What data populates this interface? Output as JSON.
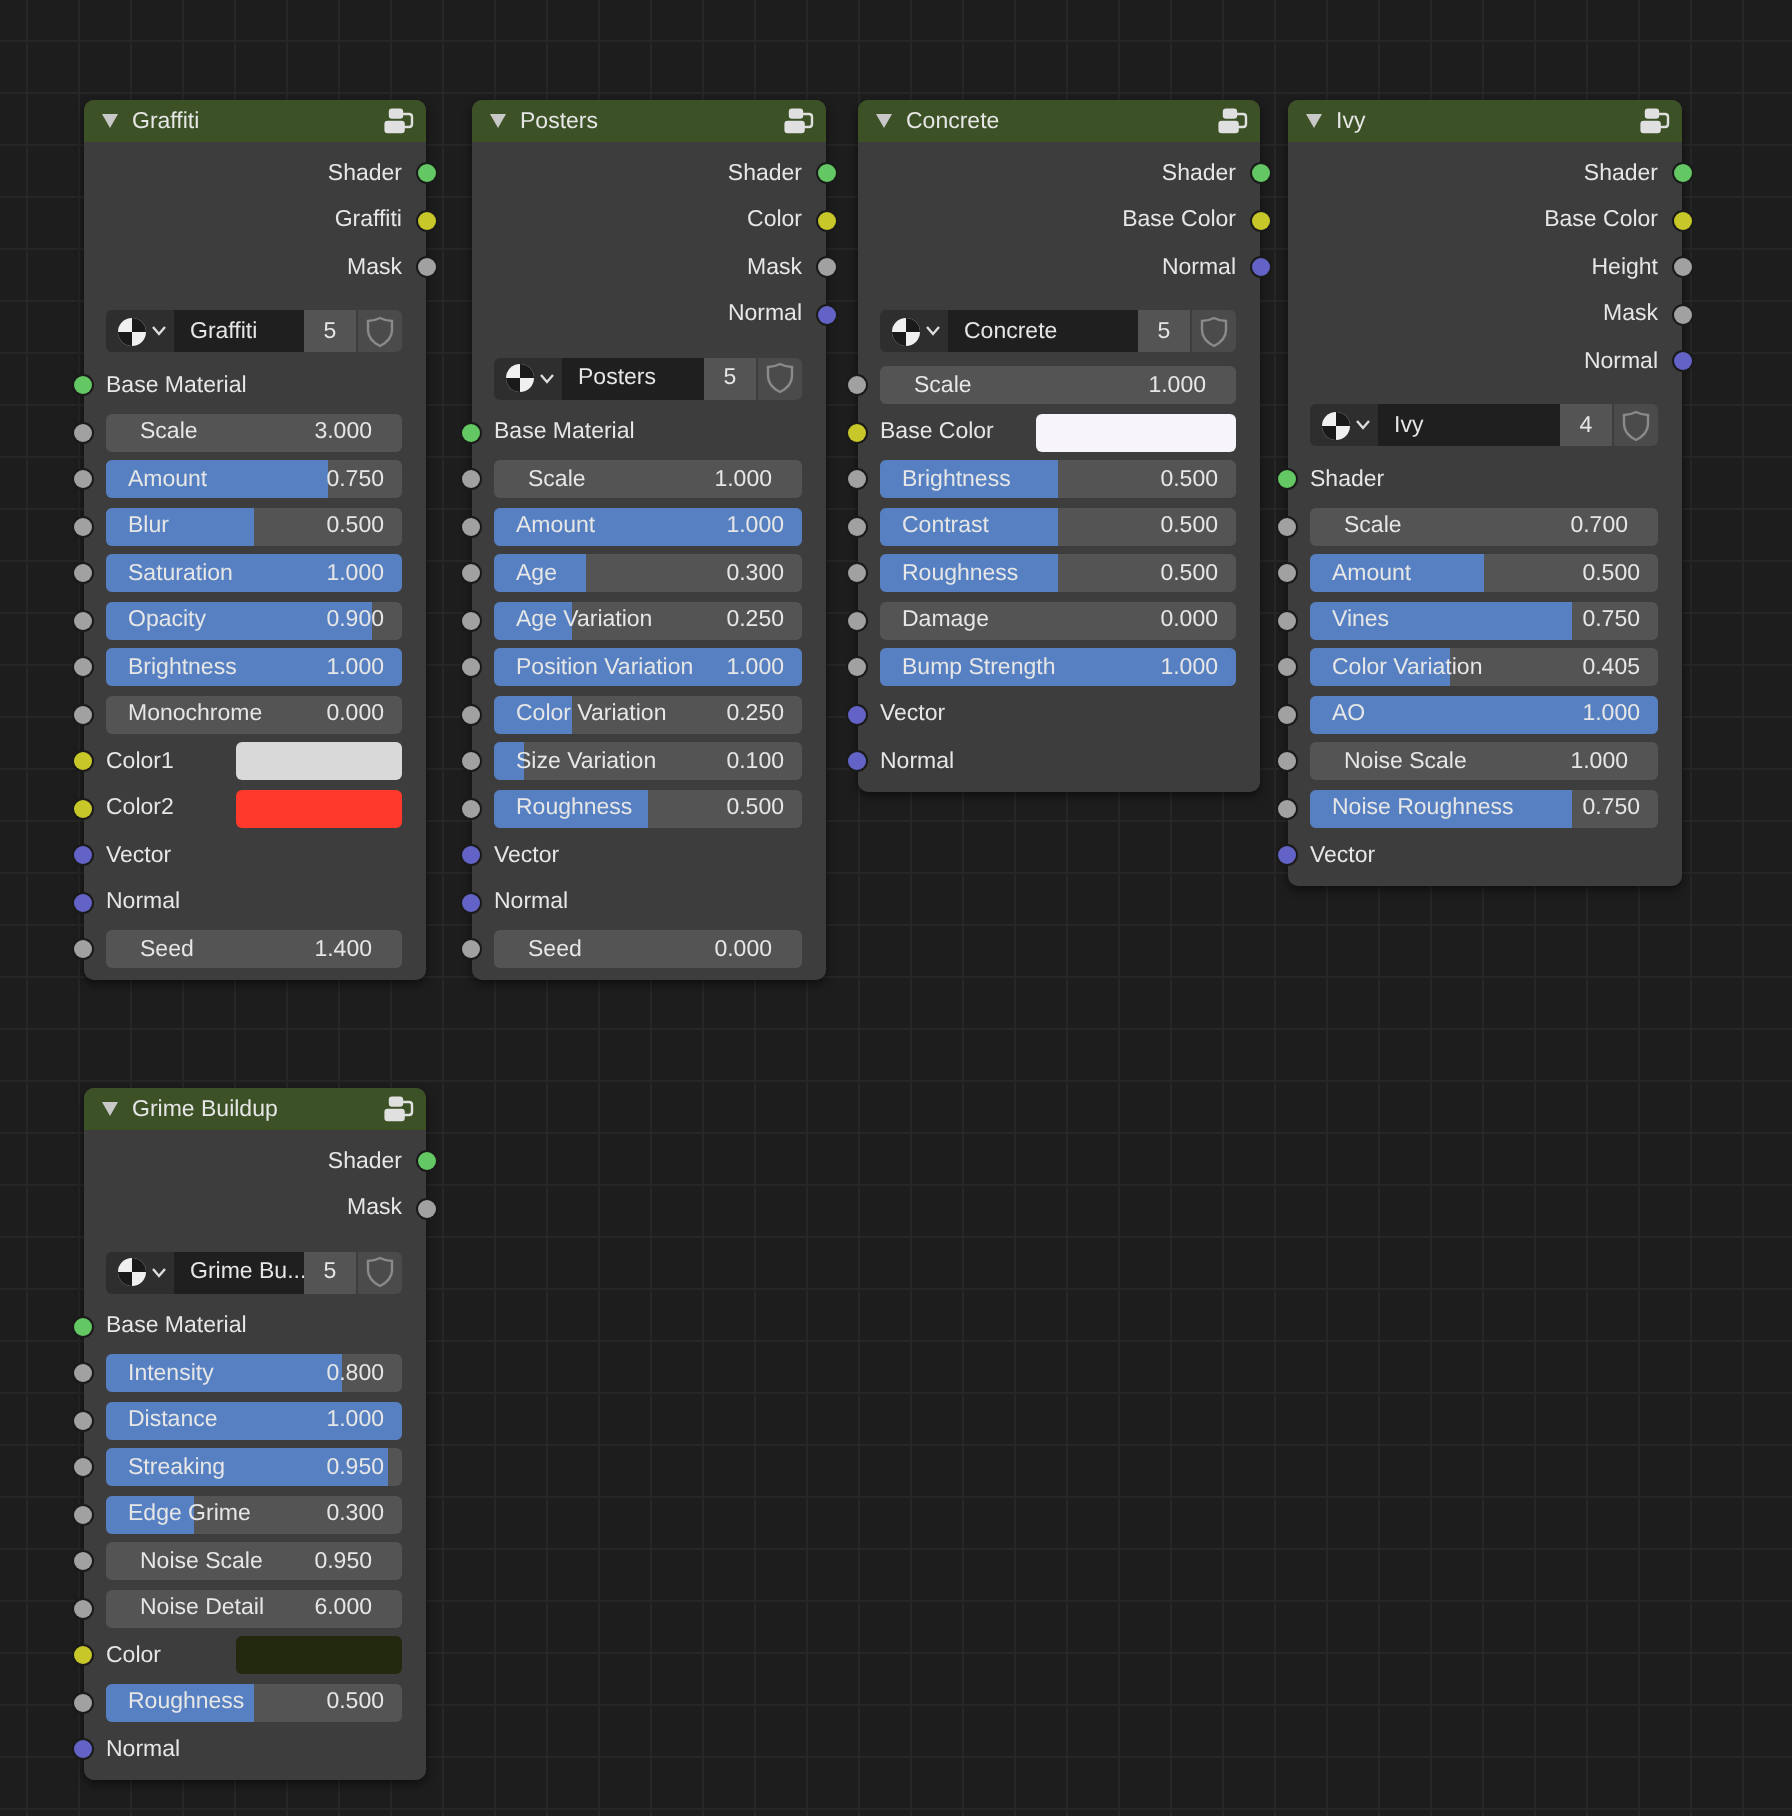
{
  "nodes": [
    {
      "title": "Graffiti",
      "outputs": [
        {
          "label": "Shader",
          "color": "#63c763"
        },
        {
          "label": "Graffiti",
          "color": "#c7c729"
        },
        {
          "label": "Mask",
          "color": "#a1a1a1"
        }
      ],
      "material": {
        "name": "Graffiti",
        "users": "5"
      },
      "inputs": [
        {
          "kind": "label",
          "label": "Base Material",
          "color": "#63c763"
        },
        {
          "kind": "number",
          "label": "Scale",
          "value": "3.000",
          "color": "#a1a1a1"
        },
        {
          "kind": "slider",
          "label": "Amount",
          "value": "0.750",
          "level": 0.75,
          "color": "#a1a1a1"
        },
        {
          "kind": "slider",
          "label": "Blur",
          "value": "0.500",
          "level": 0.5,
          "color": "#a1a1a1"
        },
        {
          "kind": "slider",
          "label": "Saturation",
          "value": "1.000",
          "level": 1,
          "color": "#a1a1a1"
        },
        {
          "kind": "slider",
          "label": "Opacity",
          "value": "0.900",
          "level": 0.9,
          "color": "#a1a1a1"
        },
        {
          "kind": "slider",
          "label": "Brightness",
          "value": "1.000",
          "level": 1,
          "color": "#a1a1a1"
        },
        {
          "kind": "slider",
          "label": "Monochrome",
          "value": "0.000",
          "color": "#a1a1a1"
        },
        {
          "kind": "color",
          "label": "Color1",
          "swatch": {
            "color": "#d9d9d9"
          },
          "color": "#c7c729"
        },
        {
          "kind": "color",
          "label": "Color2",
          "swatch": {
            "color": "#ff3a2c"
          },
          "color": "#c7c729"
        },
        {
          "kind": "label",
          "label": "Vector",
          "color": "#6363c7"
        },
        {
          "kind": "label",
          "label": "Normal",
          "color": "#6363c7"
        },
        {
          "kind": "number",
          "label": "Seed",
          "value": "1.400",
          "color": "#a1a1a1"
        }
      ]
    },
    {
      "title": "Posters",
      "outputs": [
        {
          "label": "Shader",
          "color": "#63c763"
        },
        {
          "label": "Color",
          "color": "#c7c729"
        },
        {
          "label": "Mask",
          "color": "#a1a1a1"
        },
        {
          "label": "Normal",
          "color": "#6363c7"
        }
      ],
      "material": {
        "name": "Posters",
        "users": "5"
      },
      "inputs": [
        {
          "kind": "label",
          "label": "Base Material",
          "color": "#63c763"
        },
        {
          "kind": "number",
          "label": "Scale",
          "value": "1.000",
          "color": "#a1a1a1"
        },
        {
          "kind": "slider",
          "label": "Amount",
          "value": "1.000",
          "level": 1,
          "color": "#a1a1a1"
        },
        {
          "kind": "slider",
          "label": "Age",
          "value": "0.300",
          "level": 0.3,
          "color": "#a1a1a1"
        },
        {
          "kind": "slider",
          "label": "Age Variation",
          "value": "0.250",
          "level": 0.25,
          "color": "#a1a1a1"
        },
        {
          "kind": "slider",
          "label": "Position Variation",
          "value": "1.000",
          "level": 1,
          "color": "#a1a1a1"
        },
        {
          "kind": "slider",
          "label": "Color Variation",
          "value": "0.250",
          "level": 0.25,
          "color": "#a1a1a1"
        },
        {
          "kind": "slider",
          "label": "Size Variation",
          "value": "0.100",
          "level": 0.1,
          "color": "#a1a1a1"
        },
        {
          "kind": "slider",
          "label": "Roughness",
          "value": "0.500",
          "level": 0.5,
          "color": "#a1a1a1"
        },
        {
          "kind": "label",
          "label": "Vector",
          "color": "#6363c7"
        },
        {
          "kind": "label",
          "label": "Normal",
          "color": "#6363c7"
        },
        {
          "kind": "number",
          "label": "Seed",
          "value": "0.000",
          "color": "#a1a1a1"
        }
      ]
    },
    {
      "title": "Concrete",
      "outputs": [
        {
          "label": "Shader",
          "color": "#63c763"
        },
        {
          "label": "Base Color",
          "color": "#c7c729"
        },
        {
          "label": "Normal",
          "color": "#6363c7"
        }
      ],
      "material": {
        "name": "Concrete",
        "users": "5"
      },
      "inputs": [
        {
          "kind": "number",
          "label": "Scale",
          "value": "1.000",
          "color": "#a1a1a1"
        },
        {
          "kind": "color",
          "label": "Base Color",
          "swatch": {
            "color": "#f8f4fc"
          },
          "color": "#c7c729"
        },
        {
          "kind": "slider",
          "label": "Brightness",
          "value": "0.500",
          "level": 0.5,
          "color": "#a1a1a1"
        },
        {
          "kind": "slider",
          "label": "Contrast",
          "value": "0.500",
          "level": 0.5,
          "color": "#a1a1a1"
        },
        {
          "kind": "slider",
          "label": "Roughness",
          "value": "0.500",
          "level": 0.5,
          "color": "#a1a1a1"
        },
        {
          "kind": "slider",
          "label": "Damage",
          "value": "0.000",
          "color": "#a1a1a1"
        },
        {
          "kind": "slider",
          "label": "Bump Strength",
          "value": "1.000",
          "level": 1,
          "color": "#a1a1a1"
        },
        {
          "kind": "label",
          "label": "Vector",
          "color": "#6363c7"
        },
        {
          "kind": "label",
          "label": "Normal",
          "color": "#6363c7"
        }
      ]
    },
    {
      "title": "Ivy",
      "outputs": [
        {
          "label": "Shader",
          "color": "#63c763"
        },
        {
          "label": "Base Color",
          "color": "#c7c729"
        },
        {
          "label": "Height",
          "color": "#a1a1a1"
        },
        {
          "label": "Mask",
          "color": "#a1a1a1"
        },
        {
          "label": "Normal",
          "color": "#6363c7"
        }
      ],
      "material": {
        "name": "Ivy",
        "users": "4"
      },
      "inputs": [
        {
          "kind": "label",
          "label": "Shader",
          "color": "#63c763"
        },
        {
          "kind": "number",
          "label": "Scale",
          "value": "0.700",
          "color": "#a1a1a1"
        },
        {
          "kind": "slider",
          "label": "Amount",
          "value": "0.500",
          "level": 0.5,
          "color": "#a1a1a1"
        },
        {
          "kind": "slider",
          "label": "Vines",
          "value": "0.750",
          "level": 0.75,
          "color": "#a1a1a1"
        },
        {
          "kind": "slider",
          "label": "Color Variation",
          "value": "0.405",
          "level": 0.405,
          "color": "#a1a1a1"
        },
        {
          "kind": "slider",
          "label": "AO",
          "value": "1.000",
          "level": 1,
          "color": "#a1a1a1"
        },
        {
          "kind": "number",
          "label": "Noise Scale",
          "value": "1.000",
          "color": "#a1a1a1"
        },
        {
          "kind": "slider",
          "label": "Noise Roughness",
          "value": "0.750",
          "level": 0.75,
          "color": "#a1a1a1"
        },
        {
          "kind": "label",
          "label": "Vector",
          "color": "#6363c7"
        }
      ]
    },
    {
      "title": "Grime Buildup",
      "outputs": [
        {
          "label": "Shader",
          "color": "#63c763"
        },
        {
          "label": "Mask",
          "color": "#a1a1a1"
        }
      ],
      "material": {
        "name": "Grime Bu...",
        "users": "5"
      },
      "inputs": [
        {
          "kind": "label",
          "label": "Base Material",
          "color": "#63c763"
        },
        {
          "kind": "slider",
          "label": "Intensity",
          "value": "0.800",
          "level": 0.8,
          "color": "#a1a1a1"
        },
        {
          "kind": "slider",
          "label": "Distance",
          "value": "1.000",
          "level": 1,
          "color": "#a1a1a1"
        },
        {
          "kind": "slider",
          "label": "Streaking",
          "value": "0.950",
          "level": 0.95,
          "color": "#a1a1a1"
        },
        {
          "kind": "slider",
          "label": "Edge Grime",
          "value": "0.300",
          "level": 0.3,
          "color": "#a1a1a1"
        },
        {
          "kind": "number",
          "label": "Noise Scale",
          "value": "0.950",
          "color": "#a1a1a1"
        },
        {
          "kind": "number",
          "label": "Noise Detail",
          "value": "6.000",
          "color": "#a1a1a1"
        },
        {
          "kind": "color",
          "label": "Color",
          "swatch": {
            "color": "#23290f"
          },
          "color": "#c7c729"
        },
        {
          "kind": "slider",
          "label": "Roughness",
          "value": "0.500",
          "level": 0.5,
          "color": "#a1a1a1"
        },
        {
          "kind": "label",
          "label": "Normal",
          "color": "#6363c7"
        }
      ]
    }
  ]
}
